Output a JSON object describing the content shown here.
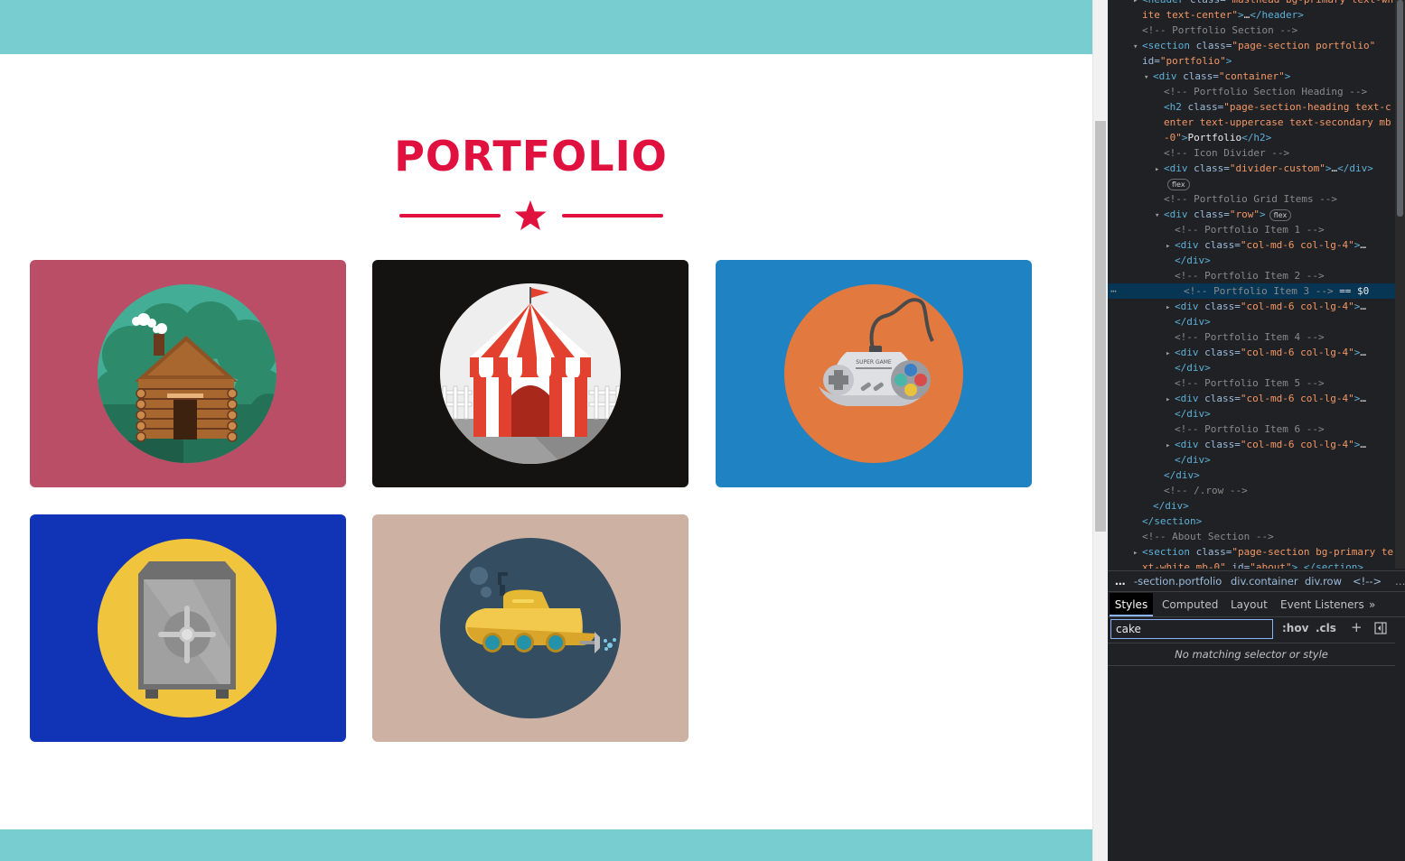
{
  "page": {
    "heading": "Portfolio",
    "colors": {
      "band": "#78cdd1",
      "accent": "#e0113f"
    },
    "divider_icon": "star-icon",
    "portfolio_items": [
      {
        "name": "cabin",
        "bg": "#ba4e66",
        "icon": "cabin-icon"
      },
      {
        "name": "circus-tent",
        "bg": "#151212",
        "icon": "circus-tent-icon"
      },
      {
        "name": "game-controller",
        "bg": "#1e82c3",
        "icon": "game-controller-icon",
        "label": "SUPER GAME"
      },
      {
        "name": "safe",
        "bg": "#1133b5",
        "icon": "safe-icon"
      },
      {
        "name": "submarine",
        "bg": "#cdb2a3",
        "icon": "submarine-icon"
      }
    ]
  },
  "devtools": {
    "dom_lines": [
      {
        "indent": 0,
        "tri": "▸",
        "html": [
          [
            "tg",
            "<header "
          ],
          [
            "an",
            "class="
          ],
          [
            "av",
            "\"masthead bg-primary text-wh"
          ]
        ]
      },
      {
        "indent": 0,
        "tri": "",
        "html": [
          [
            "av",
            "ite text-center\""
          ],
          [
            "tg",
            ">"
          ],
          [
            "tx",
            "…"
          ],
          [
            "tg",
            "</header>"
          ]
        ]
      },
      {
        "indent": 0,
        "tri": "",
        "html": [
          [
            "cm",
            "<!-- Portfolio Section -->"
          ]
        ]
      },
      {
        "indent": 0,
        "tri": "▾",
        "html": [
          [
            "tg",
            "<section "
          ],
          [
            "an",
            "class="
          ],
          [
            "av",
            "\"page-section portfolio\""
          ]
        ]
      },
      {
        "indent": 0,
        "tri": "",
        "html": [
          [
            "an",
            "id="
          ],
          [
            "av",
            "\"portfolio\""
          ],
          [
            "tg",
            ">"
          ]
        ]
      },
      {
        "indent": 1,
        "tri": "▾",
        "html": [
          [
            "tg",
            "<div "
          ],
          [
            "an",
            "class="
          ],
          [
            "av",
            "\"container\""
          ],
          [
            "tg",
            ">"
          ]
        ]
      },
      {
        "indent": 2,
        "tri": "",
        "html": [
          [
            "cm",
            "<!-- Portfolio Section Heading -->"
          ]
        ]
      },
      {
        "indent": 2,
        "tri": "",
        "html": [
          [
            "tg",
            "<h2 "
          ],
          [
            "an",
            "class="
          ],
          [
            "av",
            "\"page-section-heading text-c"
          ]
        ]
      },
      {
        "indent": 2,
        "tri": "",
        "html": [
          [
            "av",
            "enter text-uppercase text-secondary mb"
          ]
        ]
      },
      {
        "indent": 2,
        "tri": "",
        "html": [
          [
            "av",
            "-0\""
          ],
          [
            "tg",
            ">"
          ],
          [
            "tx",
            "Portfolio"
          ],
          [
            "tg",
            "</h2>"
          ]
        ]
      },
      {
        "indent": 2,
        "tri": "",
        "html": [
          [
            "cm",
            "<!-- Icon Divider -->"
          ]
        ]
      },
      {
        "indent": 2,
        "tri": "▸",
        "html": [
          [
            "tg",
            "<div "
          ],
          [
            "an",
            "class="
          ],
          [
            "av",
            "\"divider-custom\""
          ],
          [
            "tg",
            ">"
          ],
          [
            "tx",
            "…"
          ],
          [
            "tg",
            "</div>"
          ]
        ]
      },
      {
        "indent": 2,
        "tri": "",
        "pill": "flex",
        "html": []
      },
      {
        "indent": 2,
        "tri": "",
        "html": [
          [
            "cm",
            "<!-- Portfolio Grid Items -->"
          ]
        ]
      },
      {
        "indent": 2,
        "tri": "▾",
        "pill": "flex",
        "html": [
          [
            "tg",
            "<div "
          ],
          [
            "an",
            "class="
          ],
          [
            "av",
            "\"row\""
          ],
          [
            "tg",
            ">"
          ]
        ]
      },
      {
        "indent": 3,
        "tri": "",
        "html": [
          [
            "cm",
            "<!-- Portfolio Item 1 -->"
          ]
        ]
      },
      {
        "indent": 3,
        "tri": "▸",
        "html": [
          [
            "tg",
            "<div "
          ],
          [
            "an",
            "class="
          ],
          [
            "av",
            "\"col-md-6 col-lg-4\""
          ],
          [
            "tg",
            ">"
          ],
          [
            "tx",
            "…"
          ]
        ]
      },
      {
        "indent": 3,
        "tri": "",
        "html": [
          [
            "tg",
            "</div>"
          ]
        ]
      },
      {
        "indent": 3,
        "tri": "",
        "html": [
          [
            "cm",
            "<!-- Portfolio Item 2 -->"
          ]
        ]
      },
      {
        "indent": 3,
        "tri": "",
        "sel": true,
        "html": [
          [
            "cm",
            "<!-- Portfolio Item 3 --> "
          ],
          [
            "tx",
            "== $0"
          ]
        ]
      },
      {
        "indent": 3,
        "tri": "▸",
        "html": [
          [
            "tg",
            "<div "
          ],
          [
            "an",
            "class="
          ],
          [
            "av",
            "\"col-md-6 col-lg-4\""
          ],
          [
            "tg",
            ">"
          ],
          [
            "tx",
            "…"
          ]
        ]
      },
      {
        "indent": 3,
        "tri": "",
        "html": [
          [
            "tg",
            "</div>"
          ]
        ]
      },
      {
        "indent": 3,
        "tri": "",
        "html": [
          [
            "cm",
            "<!-- Portfolio Item 4 -->"
          ]
        ]
      },
      {
        "indent": 3,
        "tri": "▸",
        "html": [
          [
            "tg",
            "<div "
          ],
          [
            "an",
            "class="
          ],
          [
            "av",
            "\"col-md-6 col-lg-4\""
          ],
          [
            "tg",
            ">"
          ],
          [
            "tx",
            "…"
          ]
        ]
      },
      {
        "indent": 3,
        "tri": "",
        "html": [
          [
            "tg",
            "</div>"
          ]
        ]
      },
      {
        "indent": 3,
        "tri": "",
        "html": [
          [
            "cm",
            "<!-- Portfolio Item 5 -->"
          ]
        ]
      },
      {
        "indent": 3,
        "tri": "▸",
        "html": [
          [
            "tg",
            "<div "
          ],
          [
            "an",
            "class="
          ],
          [
            "av",
            "\"col-md-6 col-lg-4\""
          ],
          [
            "tg",
            ">"
          ],
          [
            "tx",
            "…"
          ]
        ]
      },
      {
        "indent": 3,
        "tri": "",
        "html": [
          [
            "tg",
            "</div>"
          ]
        ]
      },
      {
        "indent": 3,
        "tri": "",
        "html": [
          [
            "cm",
            "<!-- Portfolio Item 6 -->"
          ]
        ]
      },
      {
        "indent": 3,
        "tri": "▸",
        "html": [
          [
            "tg",
            "<div "
          ],
          [
            "an",
            "class="
          ],
          [
            "av",
            "\"col-md-6 col-lg-4\""
          ],
          [
            "tg",
            ">"
          ],
          [
            "tx",
            "…"
          ]
        ]
      },
      {
        "indent": 3,
        "tri": "",
        "html": [
          [
            "tg",
            "</div>"
          ]
        ]
      },
      {
        "indent": 2,
        "tri": "",
        "html": [
          [
            "tg",
            "</div>"
          ]
        ]
      },
      {
        "indent": 2,
        "tri": "",
        "html": [
          [
            "cm",
            "<!-- /.row -->"
          ]
        ]
      },
      {
        "indent": 1,
        "tri": "",
        "html": [
          [
            "tg",
            "</div>"
          ]
        ]
      },
      {
        "indent": 0,
        "tri": "",
        "html": [
          [
            "tg",
            "</section>"
          ]
        ]
      },
      {
        "indent": 0,
        "tri": "",
        "html": [
          [
            "cm",
            "<!-- About Section -->"
          ]
        ]
      },
      {
        "indent": 0,
        "tri": "▸",
        "html": [
          [
            "tg",
            "<section "
          ],
          [
            "an",
            "class="
          ],
          [
            "av",
            "\"page-section bg-primary te"
          ]
        ]
      },
      {
        "indent": 0,
        "tri": "",
        "html": [
          [
            "av",
            "xt-white mb-0\" "
          ],
          [
            "an",
            "id="
          ],
          [
            "av",
            "\"about\""
          ],
          [
            "tg",
            ">"
          ],
          [
            "tx",
            "…"
          ],
          [
            "tg",
            "</section>"
          ]
        ]
      }
    ],
    "breadcrumb": [
      "…",
      "-section.portfolio",
      "div.container",
      "div.row",
      "<!-->",
      "…"
    ],
    "tabs": [
      "Styles",
      "Computed",
      "Layout",
      "Event Listeners",
      "»"
    ],
    "filter_value": "cake",
    "filter_buttons": [
      ":hov",
      ".cls",
      "+"
    ],
    "no_match": "No matching selector or style"
  }
}
